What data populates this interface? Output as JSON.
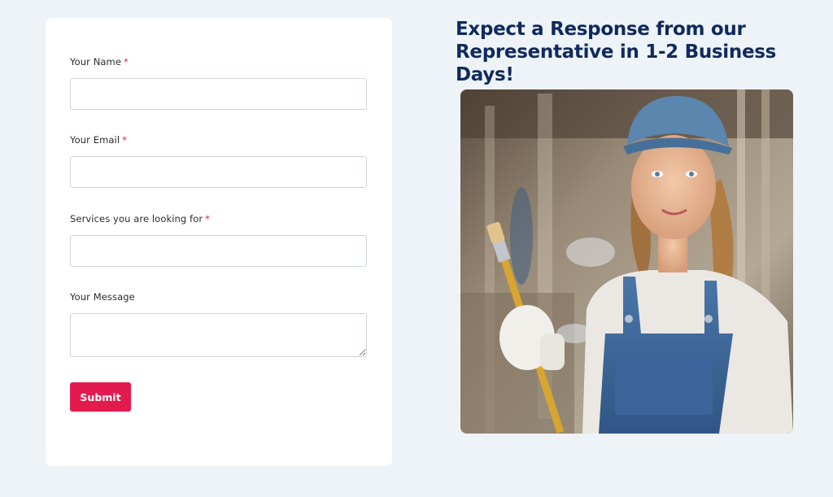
{
  "form": {
    "fields": [
      {
        "label": "Your Name",
        "required_mark": "*",
        "value": ""
      },
      {
        "label": "Your Email",
        "required_mark": "*",
        "value": ""
      },
      {
        "label": "Services you are looking for",
        "required_mark": "*",
        "value": ""
      },
      {
        "label": "Your Message",
        "value": ""
      }
    ],
    "submit_label": "Submit"
  },
  "heading": {
    "line1": "Expect a Response from our",
    "line2": "Representative in 1-2 Business Days!"
  },
  "photo": {
    "subject": "smiling-painter-with-brush"
  },
  "colors": {
    "accent": "#e21b4e",
    "heading": "#0f2a5c",
    "background": "#eef3f8"
  }
}
